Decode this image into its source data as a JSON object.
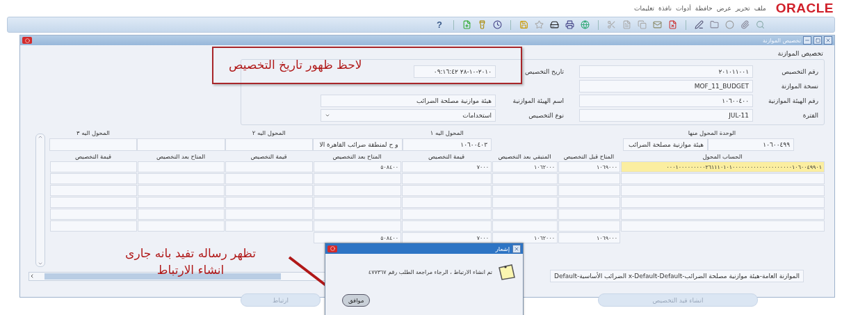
{
  "app": {
    "logo": "ORACLE",
    "menu": [
      "ملف",
      "تحرير",
      "عرض",
      "حافظة",
      "أدوات",
      "نافذة",
      "تعليمات"
    ],
    "help": "?"
  },
  "window": {
    "title": "تخصيص الموازنة",
    "section_title": "تخصيص الموازنة",
    "fields_right": [
      {
        "label": "رقم التخصيص",
        "value": "٢٠١٠١١٠٠١",
        "kind": "text"
      },
      {
        "label": "نسخة الموازنة",
        "value": "MOF_11_BUDGET",
        "kind": "text"
      },
      {
        "label": "رقم الهيئة الموازنية",
        "value": "١٠٦٠٠٤٠٠",
        "kind": "text"
      },
      {
        "label": "الفترة",
        "value": "JUL-11",
        "kind": "text"
      }
    ],
    "fields_middle": [
      {
        "label": "تاريخ التخصيص",
        "value": "٢٠١٠-١٠-٢٨ ٠٩:١٦:٤٢",
        "kind": "text"
      },
      {
        "label": "اسم الهيئة الموازنية",
        "value": "هيئة موازنية مصلحة الضرائب",
        "kind": "text"
      },
      {
        "label": "نوع التخصيص",
        "value": "استخدامات",
        "kind": "select"
      }
    ],
    "transfer_from": {
      "label": "الوحدة المحول منها",
      "code": "١٠٦٠٠٤٩٩",
      "name": "هيئة موازنية مصلحة الضرائب"
    },
    "transfer_to": [
      {
        "label": "المحول اليه ١",
        "code": "١٠٦٠٠٤٠٣",
        "name": "و ح لمنطقة ضرائب القاهرة الا"
      },
      {
        "label": "المحول اليه ٢"
      },
      {
        "label": "المحول اليه ٣"
      }
    ],
    "table": {
      "columns": [
        "الحساب المحول",
        "المتاح قبل التخصيص",
        "المتبقي بعد التخصيص",
        "قيمة التخصيص",
        "المتاح بعد التخصيص",
        "قيمة التخصيص",
        "المتاح بعد التخصيص",
        "قيمة التخصيص"
      ],
      "rows": [
        {
          "selected": true,
          "cells": [
            "٠٠٠١٠٠٠٠٠٠٠٠٠٢٦١١١٠١٠١٠٠٠٠٠٠٠٠٠٠٠٠٠٠٠٠٠٠٠٠١٠٦٠٠٤٩٩٠١",
            "١٠٦٩٠٠٠",
            "١٠٦٢٠٠٠",
            "٧٠٠٠",
            "٥٠٨٤٠٠"
          ]
        }
      ],
      "totals": [
        "١٠٦٩٠٠٠",
        "١٠٦٢٠٠٠",
        "٧٠٠٠",
        "٥٠٨٤٠٠"
      ]
    },
    "description": "الموازنة العامة-هيئة موازنية مصلحة الضرائب-x-Default-Default الضرائب الأساسية-Default",
    "buttons": [
      {
        "label": "انشاء قيد التخصيص",
        "disabled": true
      },
      {
        "label": "ارتباط",
        "disabled": true
      }
    ]
  },
  "dialog": {
    "title": "إشعار",
    "message": "تم انشاء الارتباط ، الرجاء مراجعة الطلب رقم ٤٧٧٣٦٧",
    "button": "موافق"
  },
  "annotations": [
    {
      "kind": "boxed",
      "text": "لاحظ ظهور تاريخ التخصيص"
    },
    {
      "kind": "arrow",
      "text": "تظهر رساله تفيد بانه جارى انشاء الارتباط"
    }
  ]
}
